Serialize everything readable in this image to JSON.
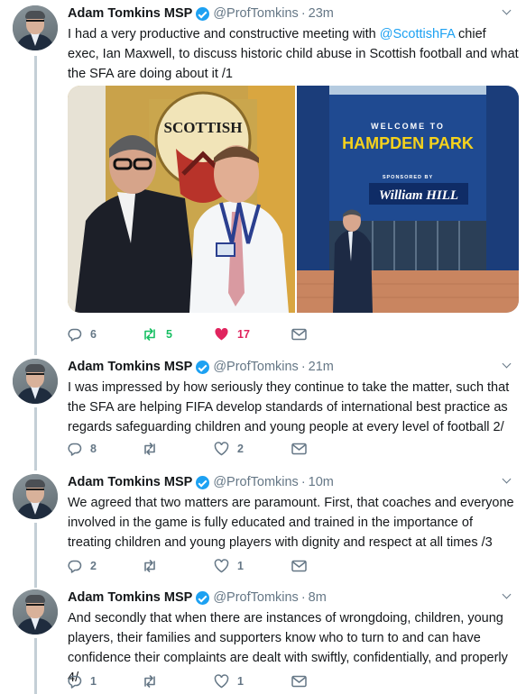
{
  "tweets": [
    {
      "name": "Adam Tomkins MSP",
      "handle": "@ProfTomkins",
      "separator": "·",
      "time": "23m",
      "text_before": "I had a very productive and constructive meeting with ",
      "mention": "@ScottishFA",
      "text_after": " chief exec, Ian Maxwell, to discuss historic child abuse in Scottish football and what the SFA are doing about it /1",
      "replies": "6",
      "retweets": "5",
      "likes": "17",
      "retweeted": true,
      "liked": true,
      "media": {
        "left_photo_sign": "SCOTTISH",
        "right_photo_sign_top": "WELCOME TO",
        "right_photo_sign_main": "HAMPDEN PARK",
        "right_photo_sign_sponsor": "SPONSORED BY",
        "right_photo_sign_brand": "William HILL"
      }
    },
    {
      "name": "Adam Tomkins MSP",
      "handle": "@ProfTomkins",
      "separator": "·",
      "time": "21m",
      "text": "I was impressed by how seriously they continue to take the matter, such that the SFA are helping FIFA develop standards of international best practice as regards safeguarding children and young people at every level of football 2/",
      "replies": "8",
      "retweets": "",
      "likes": "2"
    },
    {
      "name": "Adam Tomkins MSP",
      "handle": "@ProfTomkins",
      "separator": "·",
      "time": "10m",
      "text": "We agreed that two matters are paramount. First, that coaches and everyone involved in the game is fully educated and trained in the importance of treating children and young players with dignity and respect at all times /3",
      "replies": "2",
      "retweets": "",
      "likes": "1"
    },
    {
      "name": "Adam Tomkins MSP",
      "handle": "@ProfTomkins",
      "separator": "·",
      "time": "8m",
      "text": "And secondly that when there are instances of wrongdoing, children, young players, their families and supporters know who to turn to and can have confidence their complaints are dealt with swiftly, confidentially, and properly 4/",
      "replies": "1",
      "retweets": "",
      "likes": "1"
    }
  ],
  "colors": {
    "accent": "#1da1f2",
    "retweet_active": "#17bf63",
    "like_active": "#e0245e",
    "muted": "#657786",
    "thread_line": "#c4cfd6"
  },
  "icons": [
    "reply-icon",
    "retweet-icon",
    "like-icon",
    "message-icon",
    "verified-badge-icon",
    "chevron-down-icon"
  ]
}
